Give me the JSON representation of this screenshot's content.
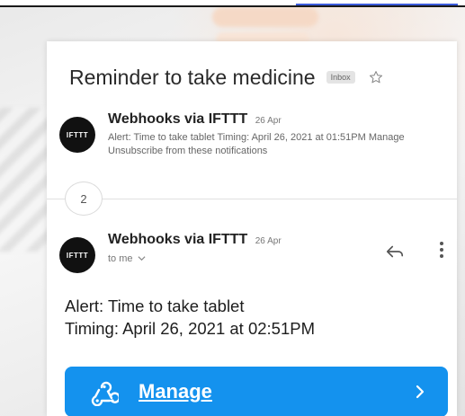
{
  "email": {
    "subject": "Reminder to take medicine",
    "label": "Inbox",
    "thread_count": "2"
  },
  "messages": [
    {
      "sender": "Webhooks via IFTTT",
      "date": "26 Apr",
      "avatar_text": "IFTTT",
      "snippet": "Alert: Time to take tablet Timing: April 26, 2021 at 01:51PM Manage Unsubscribe from these notifications"
    },
    {
      "sender": "Webhooks via IFTTT",
      "date": "26 Apr",
      "avatar_text": "IFTTT",
      "recipient": "to me",
      "body_line1": "Alert: Time to take tablet",
      "body_line2": "Timing: April 26, 2021 at 02:51PM"
    }
  ],
  "action": {
    "label": "Manage"
  },
  "colors": {
    "button": "#1492ee",
    "avatar": "#111111"
  },
  "icons": [
    "star-icon",
    "reply-icon",
    "more-icon",
    "webhook-icon",
    "chevron-right-icon",
    "chevron-down-icon"
  ]
}
